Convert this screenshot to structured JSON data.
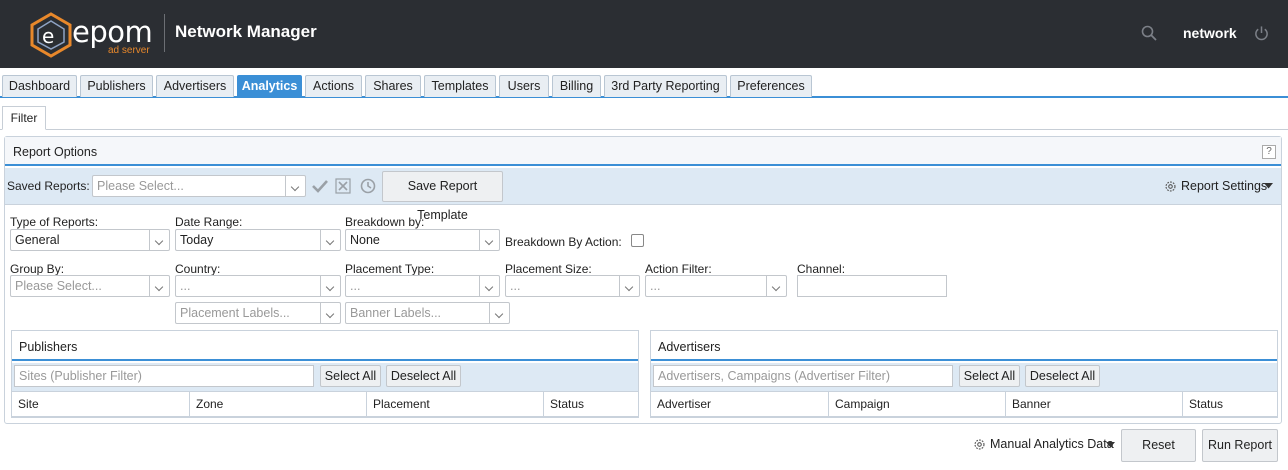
{
  "header": {
    "logo_word": "epom",
    "logo_sub": "ad server",
    "app_title": "Network Manager",
    "user_name": "network"
  },
  "tabs": [
    {
      "label": "Dashboard",
      "active": false
    },
    {
      "label": "Publishers",
      "active": false
    },
    {
      "label": "Advertisers",
      "active": false
    },
    {
      "label": "Analytics",
      "active": true
    },
    {
      "label": "Actions",
      "active": false
    },
    {
      "label": "Shares",
      "active": false
    },
    {
      "label": "Templates",
      "active": false
    },
    {
      "label": "Users",
      "active": false
    },
    {
      "label": "Billing",
      "active": false
    },
    {
      "label": "3rd Party Reporting",
      "active": false
    },
    {
      "label": "Preferences",
      "active": false
    }
  ],
  "subtab": "Filter",
  "report_options": {
    "title": "Report Options",
    "help": "?",
    "saved_reports_label": "Saved Reports:",
    "saved_reports_placeholder": "Please Select...",
    "save_template_label": "Save Report Template",
    "report_settings_label": "Report Settings"
  },
  "filters": {
    "type_label": "Type of Reports:",
    "type_value": "General",
    "date_label": "Date Range:",
    "date_value": "Today",
    "breakdown_label": "Breakdown by:",
    "breakdown_value": "None",
    "breakdown_action_label": "Breakdown By Action:",
    "group_label": "Group By:",
    "group_placeholder": "Please Select...",
    "country_label": "Country:",
    "country_value": "...",
    "placement_type_label": "Placement Type:",
    "placement_type_value": "...",
    "placement_size_label": "Placement Size:",
    "placement_size_value": "...",
    "action_filter_label": "Action Filter:",
    "action_filter_value": "...",
    "channel_label": "Channel:",
    "placement_labels_placeholder": "Placement Labels...",
    "banner_labels_placeholder": "Banner Labels..."
  },
  "publishers": {
    "title": "Publishers",
    "filter_placeholder": "Sites (Publisher Filter)",
    "select_all": "Select All",
    "deselect_all": "Deselect All",
    "columns": [
      "Site",
      "Zone",
      "Placement",
      "Status"
    ]
  },
  "advertisers": {
    "title": "Advertisers",
    "filter_placeholder": "Advertisers, Campaigns (Advertiser Filter)",
    "select_all": "Select All",
    "deselect_all": "Deselect All",
    "columns": [
      "Advertiser",
      "Campaign",
      "Banner",
      "Status"
    ]
  },
  "footer": {
    "manual_label": "Manual Analytics Data",
    "reset_label": "Reset",
    "run_label": "Run Report"
  },
  "colors": {
    "accent": "#3b8fd6",
    "topbar": "#2b2e33",
    "logo_orange": "#e8882b"
  }
}
